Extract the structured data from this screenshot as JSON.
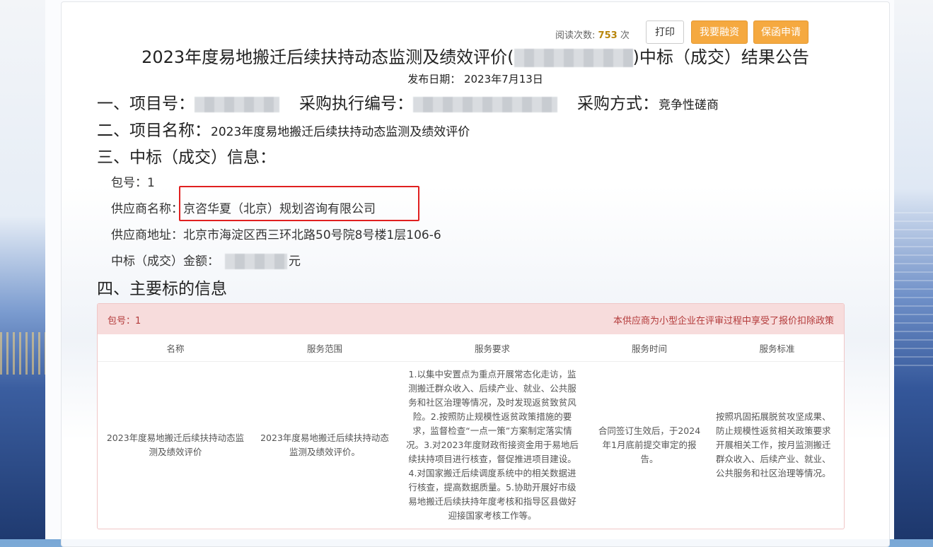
{
  "header": {
    "read_count_label": "阅读次数:",
    "read_count_value": "753",
    "read_count_unit": "次",
    "print_label": "打印",
    "finance_label": "我要融资",
    "guarantee_label": "保函申请"
  },
  "title": {
    "prefix": "2023年度易地搬迁后续扶持动态监测及绩效评价(",
    "suffix": ")中标（成交）结果公告"
  },
  "pubdate": "发布日期： 2023年7月13日",
  "sections": {
    "s1_project_no": "一、项目号：",
    "s1_purchase_no": "采购执行编号：",
    "s1_method_label": "采购方式：",
    "s1_method_value": "竞争性磋商",
    "s2_label": "二、项目名称：",
    "s2_value": "2023年度易地搬迁后续扶持动态监测及绩效评价",
    "s3_label": "三、中标（成交）信息：",
    "s4_label": "四、主要标的信息"
  },
  "winner": {
    "package": "包号：1",
    "supplier_name_label": "供应商名称：",
    "supplier_name": "京咨华夏（北京）规划咨询有限公司",
    "supplier_addr_label": "供应商地址：",
    "supplier_addr": "北京市海淀区西三环北路50号院8号楼1层106-6",
    "amount_label": "中标（成交）金额：",
    "amount_unit": "元"
  },
  "table": {
    "package": "包号：1",
    "note": "本供应商为小型企业在评审过程中享受了报价扣除政策",
    "headers": [
      "名称",
      "服务范围",
      "服务要求",
      "服务时间",
      "服务标准"
    ],
    "row": {
      "name": "2023年度易地搬迁后续扶持动态监测及绩效评价",
      "scope": "2023年度易地搬迁后续扶持动态监测及绩效评价。",
      "requirement": "1.以集中安置点为重点开展常态化走访，监测搬迁群众收入、后续产业、就业、公共服务和社区治理等情况，及时发现返贫致贫风险。2.按照防止规模性返贫政策措施的要求，监督检查“一点一策”方案制定落实情况。3.对2023年度财政衔接资金用于易地后续扶持项目进行核查，督促推进项目建设。4.对国家搬迁后续调度系统中的相关数据进行核查，提高数据质量。5.协助开展好市级易地搬迁后续扶持年度考核和指导区县做好迎接国家考核工作等。",
      "time": "合同签订生效后，于2024年1月底前提交审定的报告。",
      "standard": "按照巩固拓展脱贫攻坚成果、防止规模性返贫相关政策要求开展相关工作，按月监测搬迁群众收入、后续产业、就业、公共服务和社区治理等情况。"
    }
  }
}
